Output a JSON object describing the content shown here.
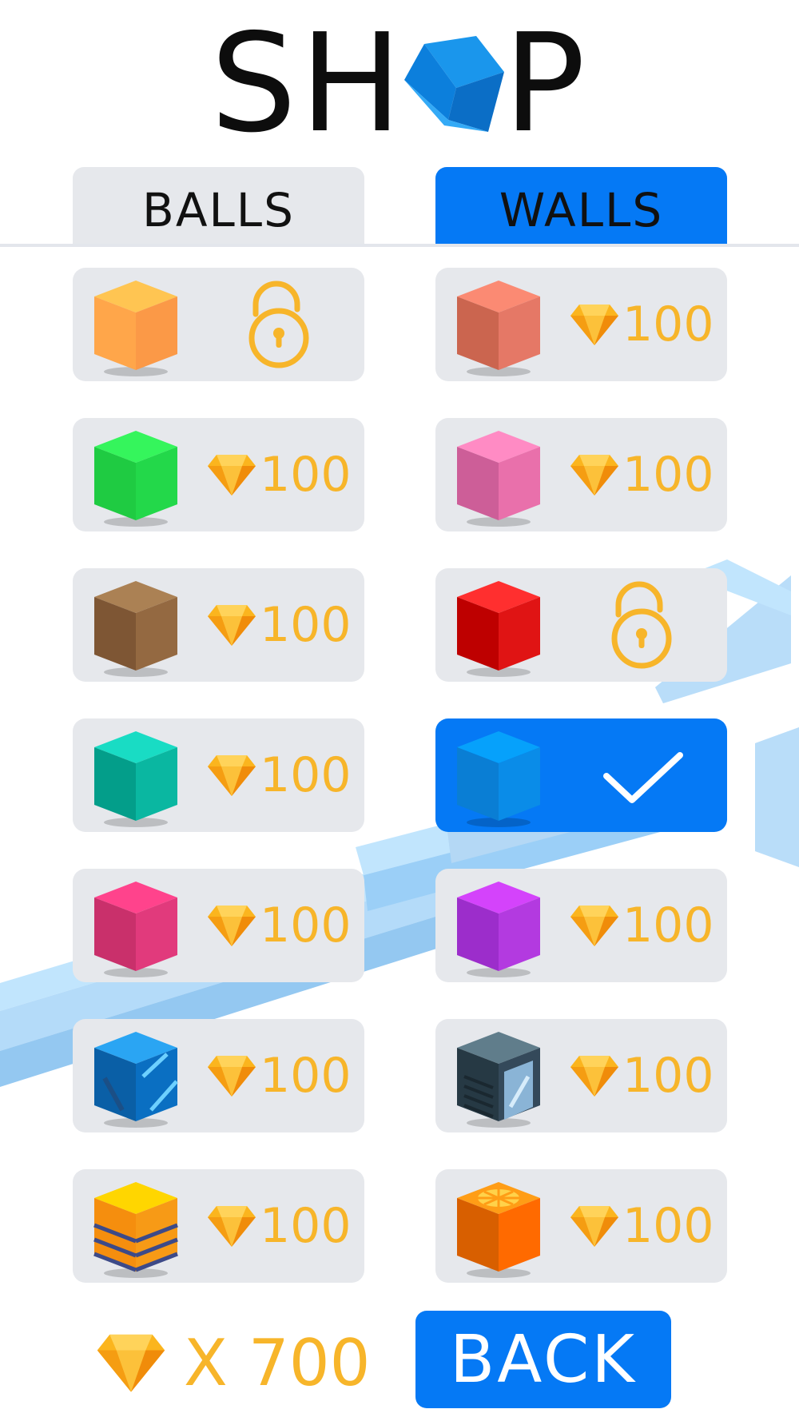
{
  "header": {
    "title_left": "SH",
    "title_right": "P",
    "logo_icon": "blue-cube-icon"
  },
  "tabs": [
    {
      "label": "BALLS",
      "active": false
    },
    {
      "label": "WALLS",
      "active": true
    }
  ],
  "colors": {
    "accent": "#0579f5",
    "card_bg": "#e6e8ec",
    "price": "#f7b52a",
    "background_blocks": "#7dc4f3"
  },
  "items": [
    {
      "id": "left-1",
      "column": "left",
      "cube": "orange-cube",
      "status": "unlocked",
      "icon": "unlock-icon"
    },
    {
      "id": "right-1",
      "column": "right",
      "cube": "salmon-cube",
      "status": "locked",
      "price": "100",
      "icon": "gem-icon"
    },
    {
      "id": "left-2",
      "column": "left",
      "cube": "green-cube",
      "status": "locked",
      "price": "100",
      "icon": "gem-icon"
    },
    {
      "id": "right-2",
      "column": "right",
      "cube": "pink-cube",
      "status": "locked",
      "price": "100",
      "icon": "gem-icon"
    },
    {
      "id": "left-3",
      "column": "left",
      "cube": "brown-cube",
      "status": "locked",
      "price": "100",
      "icon": "gem-icon"
    },
    {
      "id": "right-3",
      "column": "right",
      "cube": "red-cube",
      "status": "unlocked",
      "icon": "unlock-icon"
    },
    {
      "id": "left-4",
      "column": "left",
      "cube": "teal-cube",
      "status": "locked",
      "price": "100",
      "icon": "gem-icon"
    },
    {
      "id": "right-4",
      "column": "right",
      "cube": "blue-cube",
      "status": "selected",
      "icon": "checkmark-icon"
    },
    {
      "id": "left-5",
      "column": "left",
      "cube": "magenta-cube",
      "status": "locked",
      "price": "100",
      "icon": "gem-icon"
    },
    {
      "id": "right-5",
      "column": "right",
      "cube": "purple-cube",
      "status": "locked",
      "price": "100",
      "icon": "gem-icon"
    },
    {
      "id": "left-6",
      "column": "left",
      "cube": "blue-glass-cube",
      "status": "locked",
      "price": "100",
      "icon": "gem-icon"
    },
    {
      "id": "right-6",
      "column": "right",
      "cube": "dark-server-cube",
      "status": "locked",
      "price": "100",
      "icon": "gem-icon"
    },
    {
      "id": "left-7",
      "column": "left",
      "cube": "striped-layer-cube",
      "status": "locked",
      "price": "100",
      "icon": "gem-icon"
    },
    {
      "id": "right-7",
      "column": "right",
      "cube": "orange-slice-cube",
      "status": "locked",
      "price": "100",
      "icon": "gem-icon"
    }
  ],
  "footer": {
    "balance_prefix": "X",
    "balance_value": "700",
    "balance_icon": "gem-icon",
    "back_label": "BACK"
  }
}
